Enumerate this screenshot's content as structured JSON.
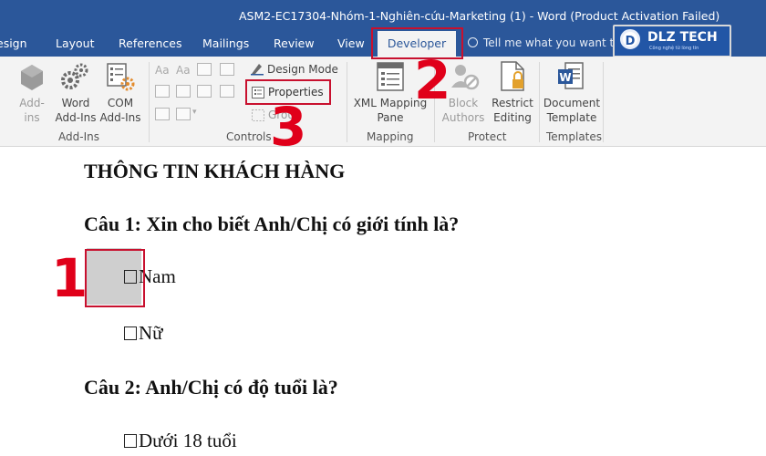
{
  "window": {
    "title": "ASM2-EC17304-Nhóm-1-Nghiên-cứu-Marketing (1) - Word (Product Activation Failed)"
  },
  "tabs": [
    {
      "label": "esign"
    },
    {
      "label": "Layout"
    },
    {
      "label": "References"
    },
    {
      "label": "Mailings"
    },
    {
      "label": "Review"
    },
    {
      "label": "View"
    },
    {
      "label": "Developer",
      "active": true
    }
  ],
  "tell_me": {
    "placeholder": "Tell me what you want to do"
  },
  "logo": {
    "text": "DLZ TECH",
    "mark": "D",
    "tagline": "Công nghệ từ lòng tin"
  },
  "ribbon": {
    "addins": {
      "group_label": "Add-Ins",
      "add_ins": [
        "Add-",
        "ins"
      ],
      "word_add_ins": [
        "Word",
        "Add-Ins"
      ],
      "com_add_ins": [
        "COM",
        "Add-Ins"
      ]
    },
    "controls": {
      "group_label": "Controls",
      "design_mode": "Design Mode",
      "properties": "Properties",
      "group_btn": "Group"
    },
    "mapping": {
      "group_label": "Mapping",
      "xml_mapping": [
        "XML Mapping",
        "Pane"
      ]
    },
    "protect": {
      "group_label": "Protect",
      "block_authors": [
        "Block",
        "Authors"
      ],
      "restrict_editing": [
        "Restrict",
        "Editing"
      ]
    },
    "templates": {
      "group_label": "Templates",
      "document_template": [
        "Document",
        "Template"
      ]
    }
  },
  "document": {
    "heading": "THÔNG TIN KHÁCH HÀNG",
    "q1": "Câu 1: Xin cho biết Anh/Chị có giới tính là?",
    "q1_options": [
      "Nam",
      "Nữ"
    ],
    "q2": "Câu 2: Anh/Chị có độ tuổi là?",
    "q2_options": [
      "Dưới 18 tuổi"
    ]
  },
  "annotations": {
    "step1": "1",
    "step2": "2",
    "step3": "3",
    "color": "#e0001a"
  },
  "colors": {
    "word_blue": "#2b579a",
    "ribbon_bg": "#f3f3f3",
    "annotation_red": "#c8102e"
  }
}
